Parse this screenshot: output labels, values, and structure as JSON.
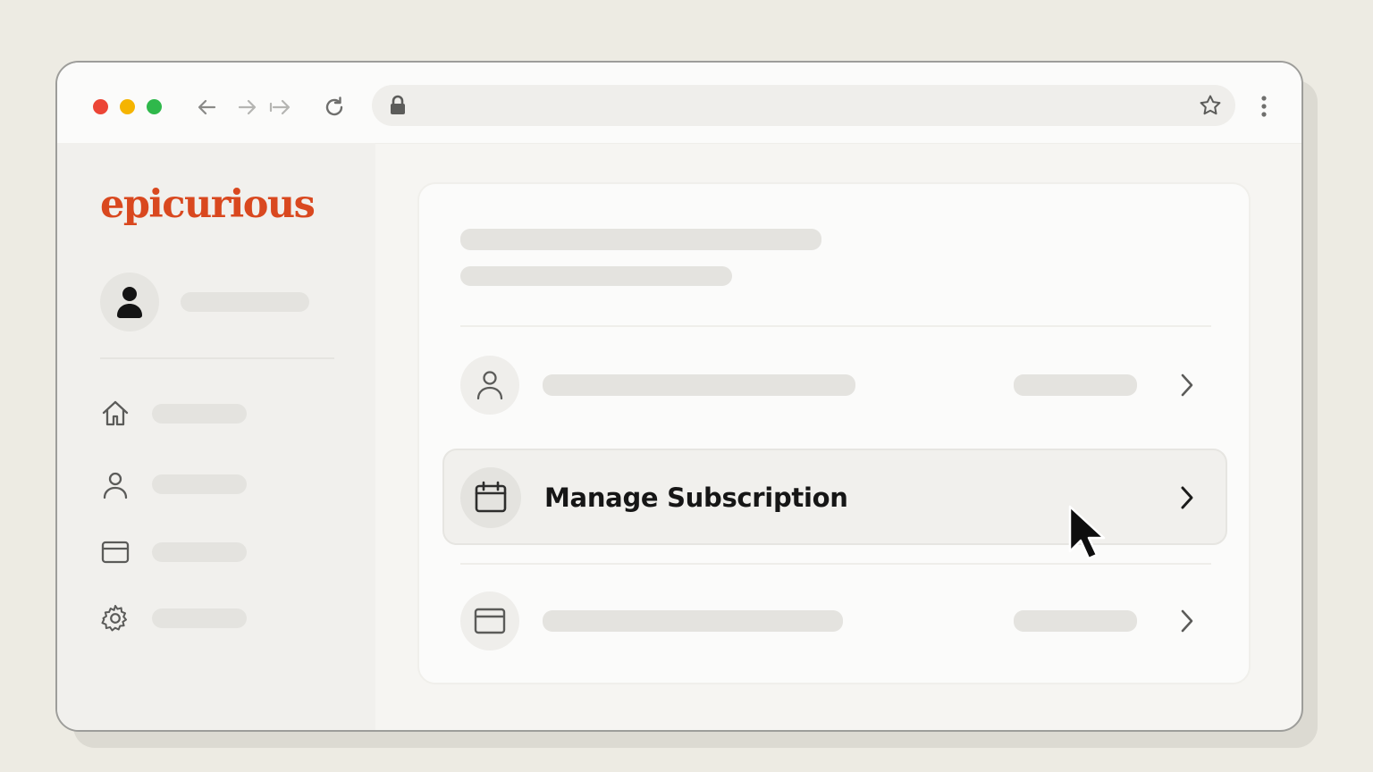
{
  "browser": {
    "traffic_lights": [
      "close",
      "minimize",
      "maximize"
    ],
    "icons": [
      "back-arrow-icon",
      "forward-arrow-icon",
      "forward-to-end-icon",
      "reload-icon",
      "lock-icon",
      "star-icon",
      "more-vertical-icon"
    ]
  },
  "sidebar": {
    "logo": "epicurious",
    "logo_color": "#d9481f",
    "nav_icons": [
      "home-icon",
      "user-icon",
      "card-icon",
      "gear-icon"
    ]
  },
  "content": {
    "rows": [
      {
        "icon": "user-icon"
      },
      {
        "icon": "calendar-icon",
        "label": "Manage Subscription",
        "highlighted": true
      },
      {
        "icon": "card-icon"
      }
    ]
  }
}
